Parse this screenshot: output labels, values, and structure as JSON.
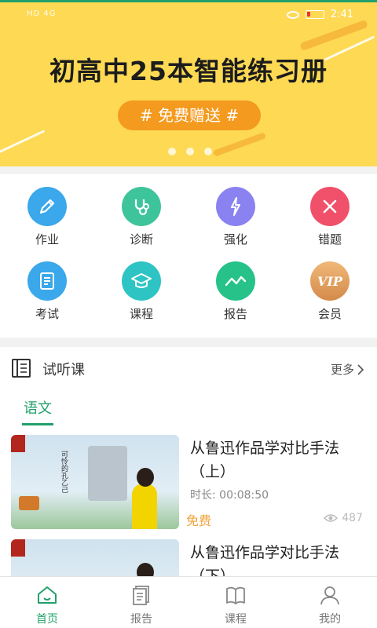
{
  "status_bar": {
    "left": "HD 4G",
    "time": "2:41",
    "battery": "4"
  },
  "banner": {
    "title": "初高中25本智能练习册",
    "promo": "# 免费赠送 #",
    "colors": {
      "background": "#fdd954",
      "pill": "#f49a1e"
    },
    "page_count": 3
  },
  "features": [
    {
      "label": "作业",
      "icon": "pencil-icon",
      "color": "#3aa8ea"
    },
    {
      "label": "诊断",
      "icon": "stethoscope-icon",
      "color": "#3ec49a"
    },
    {
      "label": "强化",
      "icon": "lightning-icon",
      "color": "#8a82f0"
    },
    {
      "label": "错题",
      "icon": "x-mark-icon",
      "color": "#f0506a"
    },
    {
      "label": "考试",
      "icon": "document-icon",
      "color": "#3aa8ea"
    },
    {
      "label": "课程",
      "icon": "graduation-cap-icon",
      "color": "#2ec4c4"
    },
    {
      "label": "报告",
      "icon": "trend-chart-icon",
      "color": "#26c28a"
    },
    {
      "label": "会员",
      "icon": "vip-icon",
      "color": "#e0a060"
    }
  ],
  "trial_section": {
    "title": "试听课",
    "more": "更多",
    "active_tab": "语文",
    "courses": [
      {
        "title": "从鲁迅作品学对比手法（上）",
        "duration": "时长: 00:08:50",
        "price": "免费",
        "views": "487"
      },
      {
        "title": "从鲁迅作品学对比手法（下）"
      }
    ],
    "thumb_text": "可怜的孔乙己"
  },
  "nav": [
    {
      "label": "首页",
      "icon": "home-icon",
      "active": true
    },
    {
      "label": "报告",
      "icon": "report-icon",
      "active": false
    },
    {
      "label": "课程",
      "icon": "course-book-icon",
      "active": false
    },
    {
      "label": "我的",
      "icon": "profile-icon",
      "active": false
    }
  ],
  "accent": "#22a06b"
}
